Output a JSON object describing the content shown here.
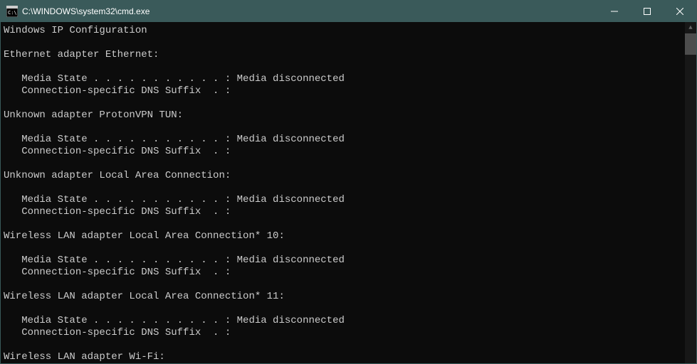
{
  "window": {
    "title": "C:\\WINDOWS\\system32\\cmd.exe"
  },
  "terminal": {
    "header": "Windows IP Configuration",
    "adapters": [
      {
        "name": "Ethernet adapter Ethernet:",
        "media_state_label": "   Media State . . . . . . . . . . . : ",
        "media_state_value": "Media disconnected",
        "dns_suffix_label": "   Connection-specific DNS Suffix  . :",
        "dns_suffix_value": ""
      },
      {
        "name": "Unknown adapter ProtonVPN TUN:",
        "media_state_label": "   Media State . . . . . . . . . . . : ",
        "media_state_value": "Media disconnected",
        "dns_suffix_label": "   Connection-specific DNS Suffix  . :",
        "dns_suffix_value": ""
      },
      {
        "name": "Unknown adapter Local Area Connection:",
        "media_state_label": "   Media State . . . . . . . . . . . : ",
        "media_state_value": "Media disconnected",
        "dns_suffix_label": "   Connection-specific DNS Suffix  . :",
        "dns_suffix_value": ""
      },
      {
        "name": "Wireless LAN adapter Local Area Connection* 10:",
        "media_state_label": "   Media State . . . . . . . . . . . : ",
        "media_state_value": "Media disconnected",
        "dns_suffix_label": "   Connection-specific DNS Suffix  . :",
        "dns_suffix_value": ""
      },
      {
        "name": "Wireless LAN adapter Local Area Connection* 11:",
        "media_state_label": "   Media State . . . . . . . . . . . : ",
        "media_state_value": "Media disconnected",
        "dns_suffix_label": "   Connection-specific DNS Suffix  . :",
        "dns_suffix_value": ""
      }
    ],
    "trailing_adapter_name": "Wireless LAN adapter Wi-Fi:"
  }
}
